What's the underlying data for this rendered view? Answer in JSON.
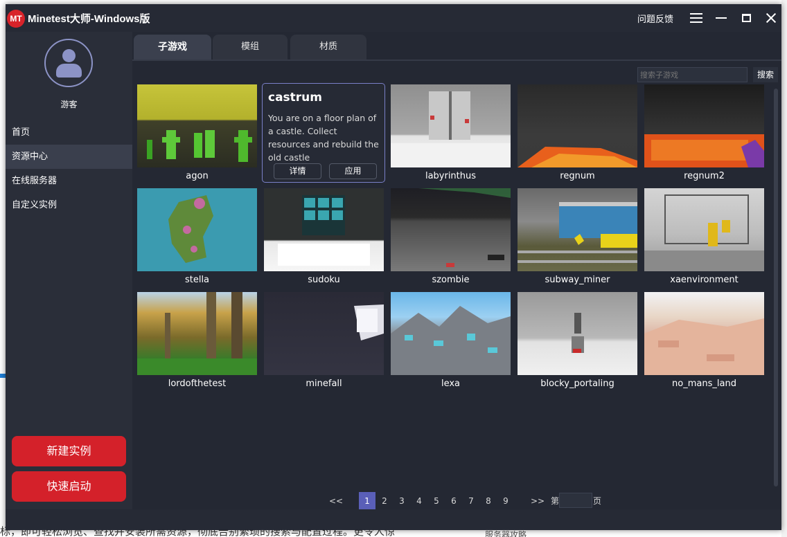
{
  "window": {
    "logo": "MT",
    "title": "Minetest大师-Windows版",
    "feedback": "问题反馈",
    "icons": [
      "menu-icon",
      "minimize-icon",
      "maximize-icon",
      "close-icon"
    ]
  },
  "background_page": {
    "text_bottom": "标，即可轻松浏览、查找并安装所需资源，彻底告别繁琐的搜索与配置过程。更令人惊",
    "text_right": "服务器攻略"
  },
  "sidebar": {
    "username": "游客",
    "nav": [
      "首页",
      "资源中心",
      "在线服务器",
      "自定义实例"
    ],
    "active_nav": "资源中心",
    "new_instance": "新建实例",
    "quick_start": "快速启动"
  },
  "tabs": [
    "子游戏",
    "模组",
    "材质"
  ],
  "active_tab": "子游戏",
  "search": {
    "placeholder": "搜索子游戏",
    "button": "搜索"
  },
  "hover_card": {
    "title": "castrum",
    "description": "You are on a floor plan of a castle. Collect resources and rebuild the old castle",
    "details_button": "详情",
    "apply_button": "应用"
  },
  "games": [
    "agon",
    "castrum",
    "labyrinthus",
    "regnum",
    "regnum2",
    "stella",
    "sudoku",
    "szombie",
    "subway_miner",
    "xaenvironment",
    "lordofthetest",
    "minefall",
    "lexa",
    "blocky_portaling",
    "no_mans_land"
  ],
  "pagination": {
    "prev": "<<",
    "pages": [
      "1",
      "2",
      "3",
      "4",
      "5",
      "6",
      "7",
      "8",
      "9"
    ],
    "current": "1",
    "next": ">>",
    "goto_prefix": "第",
    "goto_suffix": "页"
  },
  "colors": {
    "window_bg": "#262a35",
    "sidebar_bg": "#2a2e39",
    "accent_red": "#d4212a",
    "accent_purple": "#7a80c9",
    "page_active": "#5a5fb8"
  }
}
